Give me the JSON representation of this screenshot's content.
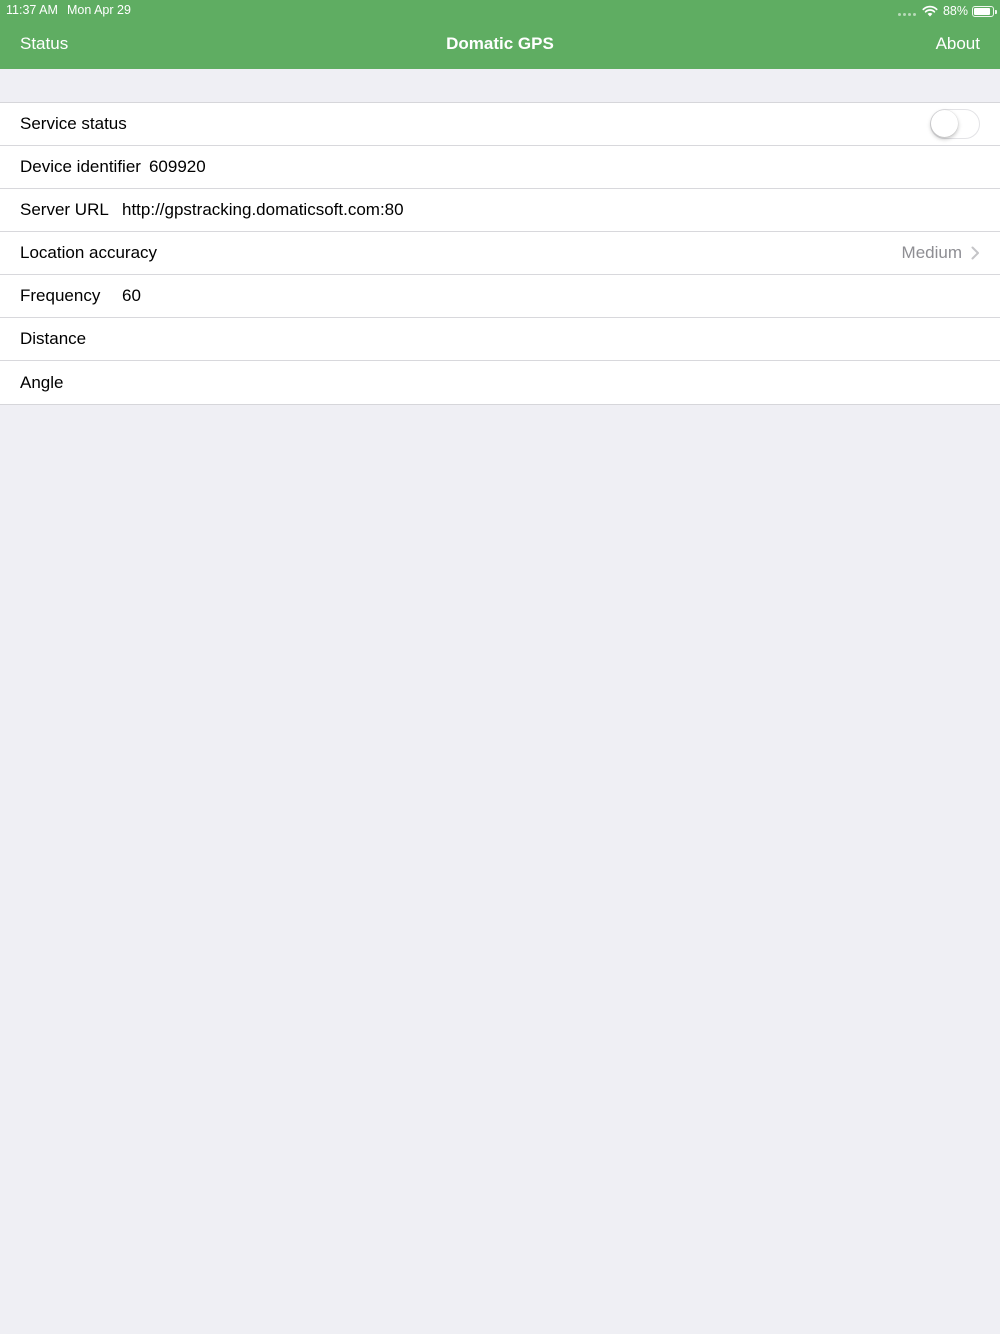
{
  "status_bar": {
    "time": "11:37 AM",
    "date": "Mon Apr 29",
    "battery": "88%",
    "battery_level": 0.88,
    "icons": [
      "cellular-dots-icon",
      "wifi-icon",
      "battery-icon"
    ]
  },
  "nav": {
    "left_label": "Status",
    "title": "Domatic GPS",
    "right_label": "About"
  },
  "settings": {
    "service_status": {
      "label": "Service status",
      "enabled": false
    },
    "device_identifier": {
      "label": "Device identifier",
      "value": "609920"
    },
    "server_url": {
      "label": "Server URL",
      "value": "http://gpstracking.domaticsoft.com:80"
    },
    "location_accuracy": {
      "label": "Location accuracy",
      "value": "Medium"
    },
    "frequency": {
      "label": "Frequency",
      "value": "60"
    },
    "distance": {
      "label": "Distance",
      "value": ""
    },
    "angle": {
      "label": "Angle",
      "value": ""
    }
  },
  "colors": {
    "header": "#5fad62",
    "background": "#efeff4",
    "detail_text": "#8e8e93"
  }
}
